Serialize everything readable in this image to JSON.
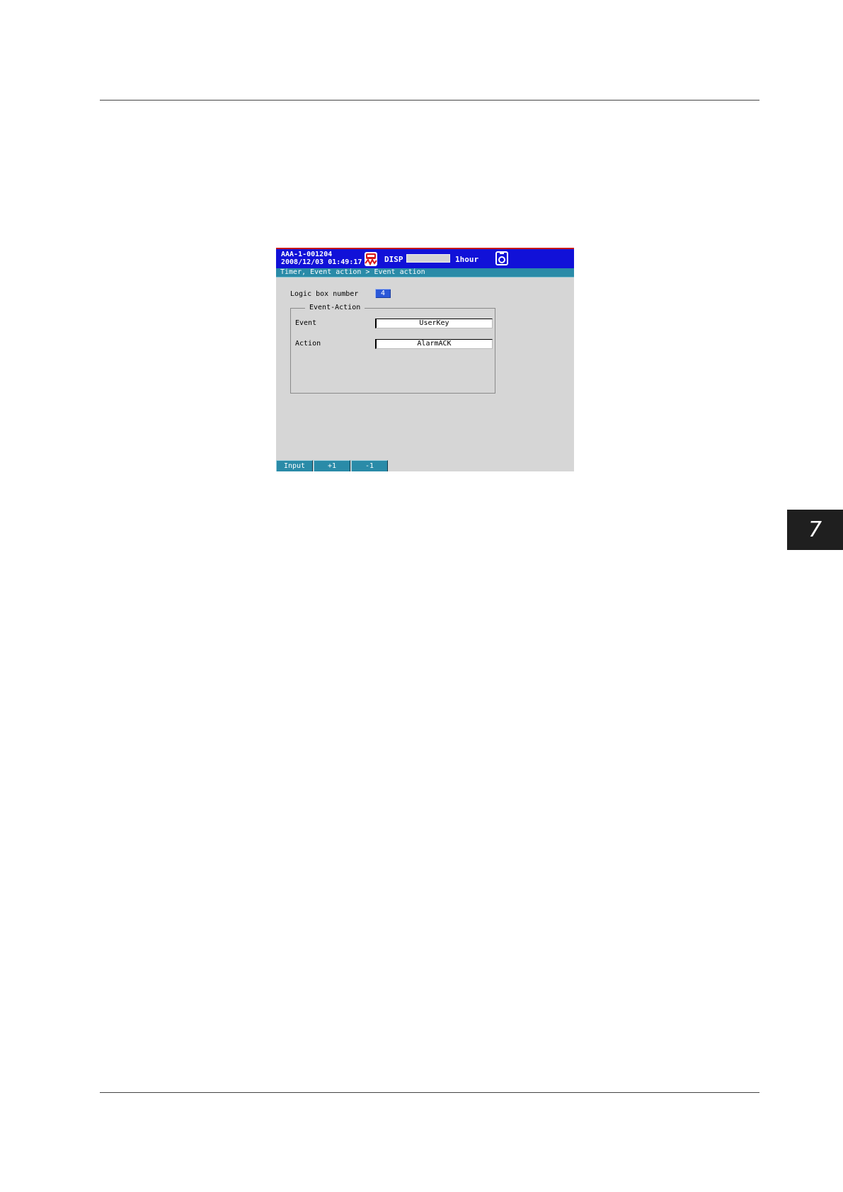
{
  "page": {
    "chapter_number": "7"
  },
  "screen": {
    "status_bar": {
      "device_id": "AAA-1-001204",
      "datetime": "2008/12/03 01:49:17",
      "logo_icon": "recorder-logo-icon",
      "mode": "DISP",
      "memory_used_fraction": 0.0,
      "interval": "1hour",
      "media_icon": "cf-card-icon",
      "colors": {
        "bar": "#1111d8",
        "top_edge": "#c81818"
      }
    },
    "breadcrumb": "Timer, Event action > Event action",
    "form": {
      "logic_box_label": "Logic box number",
      "logic_box_value": "4",
      "group_title": "Event-Action",
      "event_label": "Event",
      "event_value": "UserKey",
      "action_label": "Action",
      "action_value": "AlarmACK"
    },
    "softkeys": {
      "input": "Input",
      "plus_one": "+1",
      "minus_one": "-1"
    },
    "colors": {
      "background": "#d6d6d6",
      "breadcrumb": "#2a8ba8",
      "selected_field": "#2b58d8"
    }
  }
}
